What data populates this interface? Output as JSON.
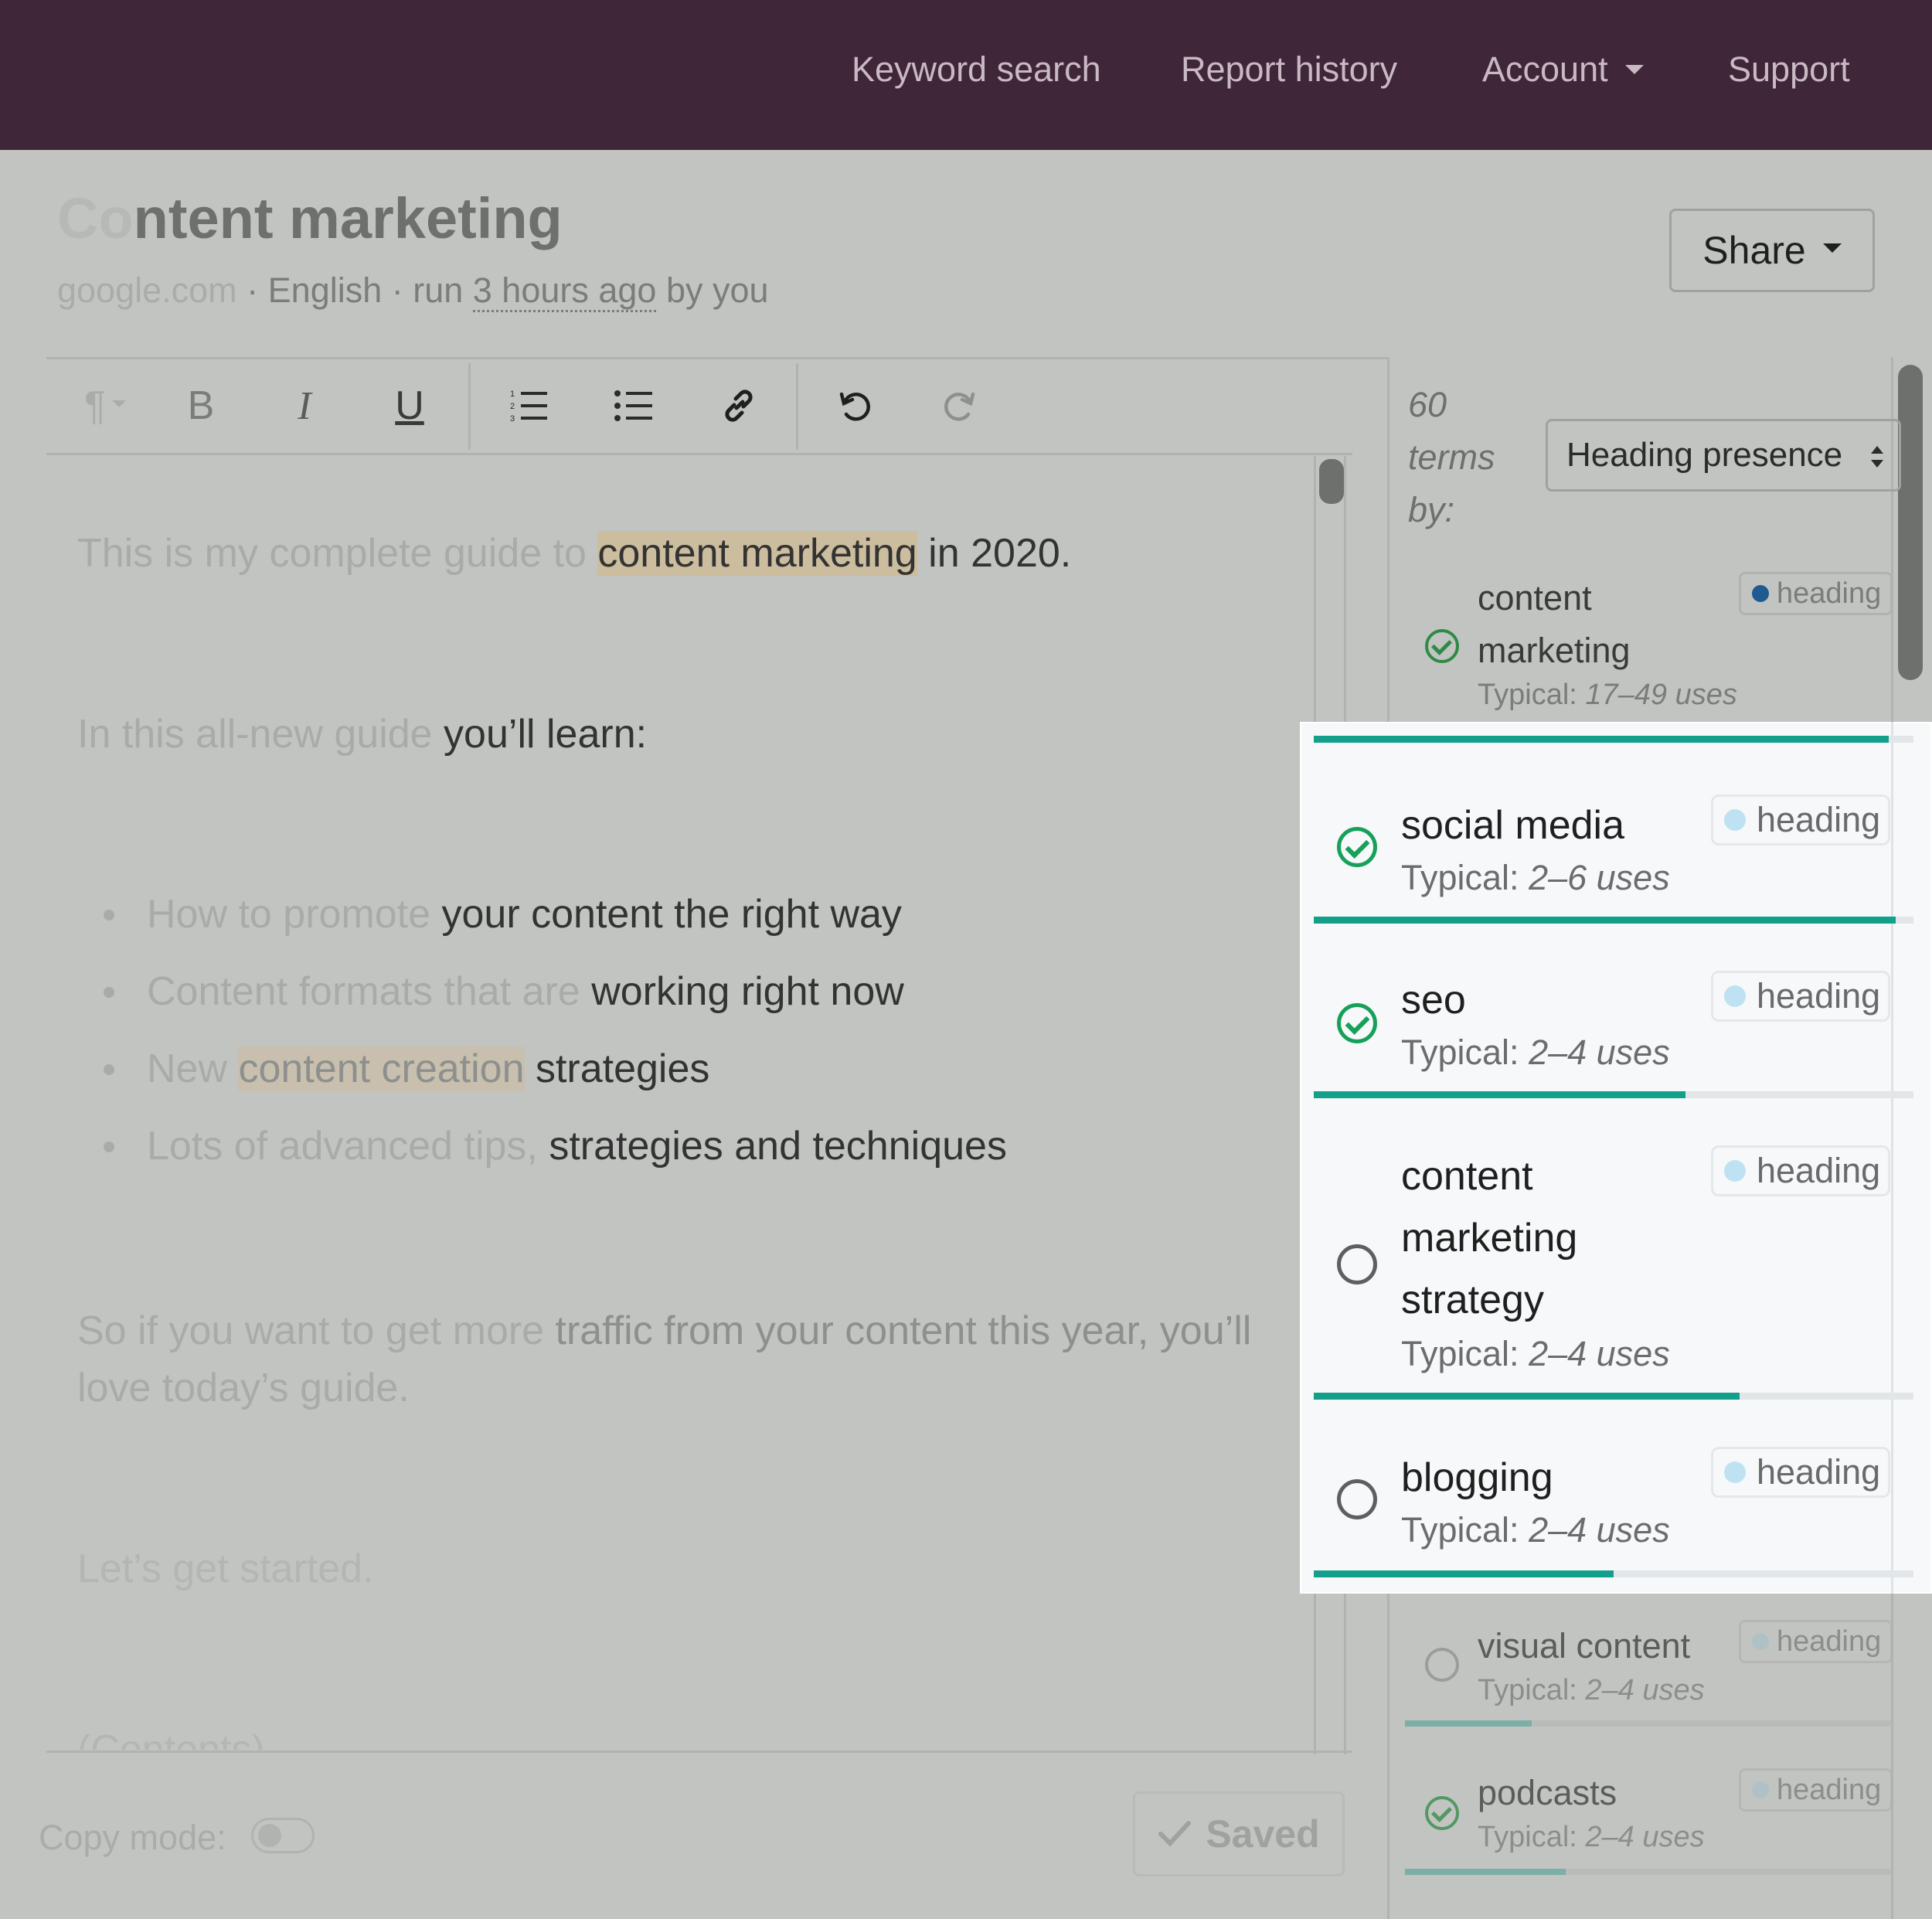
{
  "nav": {
    "items": [
      {
        "label": "Keyword search"
      },
      {
        "label": "Report history"
      },
      {
        "label": "Account"
      },
      {
        "label": "Support"
      }
    ]
  },
  "report": {
    "title_faded": "Co",
    "title_rest": "ntent marketing",
    "meta_faded": "google.com",
    "meta_mid": " · English · run ",
    "meta_link": "3 hours ago",
    "meta_end": " by you",
    "share_label": "Share"
  },
  "editor": {
    "toolbar": {
      "paragraph": "¶",
      "bold": "B",
      "italic": "I",
      "underline": "U"
    },
    "paragraphs": [
      {
        "faded": "This is my complete guide to ",
        "highlight": "content marketing",
        "rest": " in 2020."
      },
      {
        "faded": "In this all-new guide ",
        "rest": "you’ll learn:"
      }
    ],
    "bullets": [
      {
        "faded": "How to promote ",
        "rest": "your content the right way"
      },
      {
        "faded": "Content formats that are ",
        "rest": "working right now"
      },
      {
        "faded": "New ",
        "highlight": "content creation",
        "rest": " strategies"
      },
      {
        "faded": "Lots of advanced tips, ",
        "rest": "strategies and techniques"
      }
    ],
    "closing": {
      "line1_faded": "So if you want to get more ",
      "line1_rest": "traffic from your content this year, you’ll",
      "line2": "love today’s guide."
    },
    "started": "Let’s get started.",
    "contents_partial": "(Contents)",
    "copy_mode_label": "Copy mode:",
    "saved_label": "Saved"
  },
  "terms_panel": {
    "count": "60",
    "count_label_1": "terms",
    "count_label_2": "by:",
    "sort_value": "Heading presence",
    "typical_prefix": "Typical: ",
    "terms": [
      {
        "name": "content marketing",
        "line1": "content",
        "line2": "marketing",
        "typical": "17–49 uses",
        "badge": "heading",
        "checked": true,
        "progress": 1.0
      },
      {
        "name": "social media",
        "typical": "2–6 uses",
        "badge": "heading",
        "checked": true,
        "progress": 0.97
      },
      {
        "name": "seo",
        "typical": "2–4 uses",
        "badge": "heading",
        "checked": true,
        "progress": 0.62
      },
      {
        "name": "content marketing strategy",
        "line1": "content",
        "line2": "marketing",
        "line3": "strategy",
        "typical": "2–4 uses",
        "badge": "heading",
        "checked": false,
        "progress": 0.71
      },
      {
        "name": "blogging",
        "typical": "2–4 uses",
        "badge": "heading",
        "checked": false,
        "progress": 0.5
      },
      {
        "name": "visual content",
        "typical": "2–4 uses",
        "badge": "heading",
        "checked": false,
        "progress": 0.26
      },
      {
        "name": "podcasts",
        "typical": "2–4 uses",
        "badge": "heading",
        "checked": true,
        "progress": 0.33
      }
    ]
  },
  "colors": {
    "nav_bg": "#3f2639",
    "accent": "#13a08a",
    "check_green": "#17a05a",
    "overlay": "#c1c4c1"
  }
}
